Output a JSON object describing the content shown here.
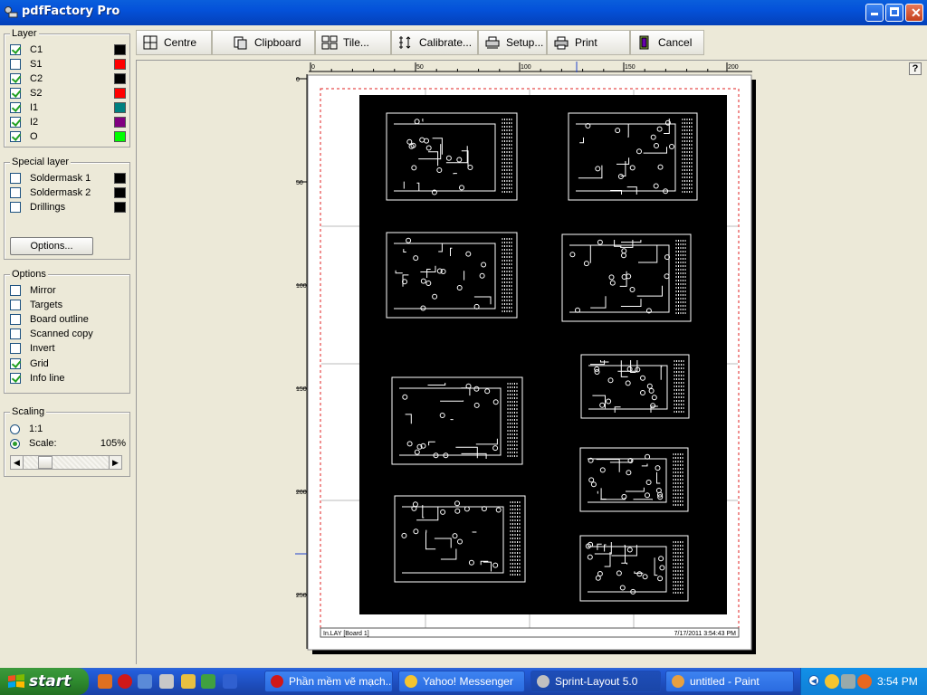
{
  "window": {
    "title": "pdfFactory Pro"
  },
  "layer_panel": {
    "legend": "Layer",
    "layers": [
      {
        "label": "C1",
        "checked": true,
        "color": "#000000"
      },
      {
        "label": "S1",
        "checked": false,
        "color": "#ff0000"
      },
      {
        "label": "C2",
        "checked": true,
        "color": "#000000"
      },
      {
        "label": "S2",
        "checked": true,
        "color": "#ff0000"
      },
      {
        "label": "I1",
        "checked": true,
        "color": "#008080"
      },
      {
        "label": "I2",
        "checked": true,
        "color": "#800080"
      },
      {
        "label": "O",
        "checked": true,
        "color": "#00ff00"
      }
    ]
  },
  "special_panel": {
    "legend": "Special layer",
    "items": [
      {
        "label": "Soldermask 1",
        "checked": false,
        "color": "#000000"
      },
      {
        "label": "Soldermask 2",
        "checked": false,
        "color": "#000000"
      },
      {
        "label": "Drillings",
        "checked": false,
        "color": "#000000"
      }
    ],
    "options_button": "Options..."
  },
  "options_panel": {
    "legend": "Options",
    "items": [
      {
        "label": "Mirror",
        "checked": false
      },
      {
        "label": "Targets",
        "checked": false
      },
      {
        "label": "Board outline",
        "checked": false
      },
      {
        "label": "Scanned copy",
        "checked": false
      },
      {
        "label": "Invert",
        "checked": false
      },
      {
        "label": "Grid",
        "checked": true
      },
      {
        "label": "Info line",
        "checked": true
      }
    ]
  },
  "scaling_panel": {
    "legend": "Scaling",
    "one_to_one": "1:1",
    "scale_label": "Scale:",
    "scale_value": "105%",
    "selected": "scale"
  },
  "toolbar": {
    "centre": "Centre",
    "clipboard": "Clipboard",
    "tile": "Tile...",
    "calibrate": "Calibrate...",
    "setup": "Setup...",
    "print": "Print",
    "cancel": "Cancel"
  },
  "help_button": "?",
  "ruler": {
    "top_ticks": [
      "0",
      "50",
      "100",
      "150",
      "200"
    ],
    "left_ticks": [
      "0",
      "50",
      "100",
      "150",
      "200",
      "250"
    ]
  },
  "page": {
    "info_left": "In.LAY [Board 1]",
    "info_right": "7/17/2011 3:54:43 PM"
  },
  "taskbar": {
    "start": "start",
    "tasks": [
      {
        "label": "Phần mềm vẽ mạch...",
        "active": false
      },
      {
        "label": "Yahoo! Messenger",
        "active": false
      },
      {
        "label": "Sprint-Layout 5.0",
        "active": true
      },
      {
        "label": "untitled - Paint",
        "active": false
      }
    ],
    "clock": "3:54 PM"
  }
}
